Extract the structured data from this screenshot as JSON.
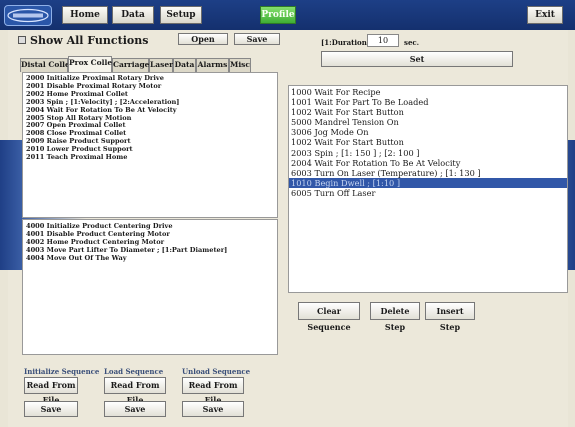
{
  "toolbar": {
    "home": "Home",
    "data": "Data",
    "setup": "Setup",
    "profile": "Profile",
    "exit": "Exit"
  },
  "functions": {
    "show_all": "Show All Functions",
    "open": "Open",
    "save": "Save",
    "tabs": [
      "Distal Collet",
      "Prox Collet",
      "Carriage",
      "Laser",
      "Data",
      "Alarms",
      "Misc"
    ],
    "active_tab": "Prox Collet",
    "list_a": [
      "2000 Initialize Proximal Rotary Drive",
      "2001 Disable Proximal Rotary Motor",
      "2002 Home Proximal Collet",
      "2003 Spin ; [1:Velocity] ; [2:Acceleration]",
      "2004 Wait For Rotation To Be At Velocity",
      "2005 Stop All Rotary Motion",
      "2007 Open Proximal Collet",
      "2008 Close Proximal Collet",
      "2009 Raise Product Support",
      "2010 Lower Product Support",
      "2011 Teach Proximal Home"
    ],
    "list_b": [
      "4000 Initialize Product Centering Drive",
      "4001 Disable Product Centering Motor",
      "4002 Home Product Centering Motor",
      "4003 Move Part Lifter To Diameter ; [1:Part Diameter]",
      "4004 Move Out Of The Way"
    ]
  },
  "duration": {
    "label": "[1:Duration]",
    "value": "10",
    "unit": "sec.",
    "set": "Set"
  },
  "sequence": {
    "items": [
      "1000 Wait For Recipe",
      "1001 Wait For Part To Be Loaded",
      "1002 Wait For Start Button",
      "5000 Mandrel Tension On",
      "3006 Jog Mode On",
      "1002 Wait For Start Button",
      "2003 Spin ; [1: 150 ]  ;  [2: 100 ]",
      "2004 Wait For Rotation To Be At Velocity",
      "6003 Turn On Laser (Temperature) ; [1: 130 ]",
      "1010 Begin Dwell ; [1:10 ]",
      "6005 Turn Off Laser"
    ],
    "selected_index": 9,
    "clear": "Clear Sequence",
    "delete": "Delete Step",
    "insert": "Insert Step"
  },
  "bottom": {
    "groups": [
      {
        "label": "Initialize Sequence",
        "read": "Read From File",
        "save": "Save"
      },
      {
        "label": "Load Sequence",
        "read": "Read From File",
        "save": "Save"
      },
      {
        "label": "Unload Sequence",
        "read": "Read From File",
        "save": "Save"
      }
    ]
  }
}
